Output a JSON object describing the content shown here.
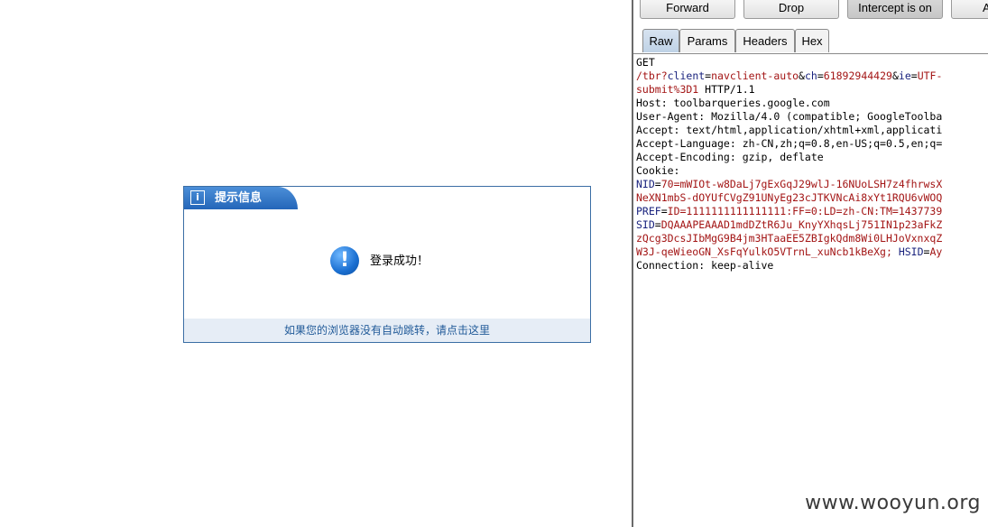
{
  "notice": {
    "title": "提示信息",
    "info_glyph": "i",
    "message": "登录成功！",
    "icon_glyph": "!",
    "redirect_link": "如果您的浏览器没有自动跳转，请点击这里"
  },
  "proxy": {
    "buttons": [
      "Forward",
      "Drop",
      "Intercept is on",
      "A"
    ],
    "tabs": [
      "Raw",
      "Params",
      "Headers",
      "Hex"
    ],
    "active_tab": "Raw",
    "request": {
      "line1": "GET",
      "line2_path": "/tbr?",
      "line2_k1": "client",
      "line2_v1": "navclient-auto",
      "line2_k2": "ch",
      "line2_v2": "61892944429",
      "line2_k3": "ie",
      "line2_v3": "UTF-",
      "line3_v": "submit%3D1",
      "line3_t": " HTTP/1.1",
      "host": "Host: toolbarqueries.google.com",
      "user_agent": "User-Agent: Mozilla/4.0 (compatible; GoogleToolba",
      "accept": "Accept: text/html,application/xhtml+xml,applicati",
      "accept_language": "Accept-Language: zh-CN,zh;q=0.8,en-US;q=0.5,en;q=",
      "accept_encoding": "Accept-Encoding: gzip, deflate",
      "cookie": "Cookie:",
      "nid_k": "NID",
      "nid_v": "70=mWIOt-w8DaLj7gExGqJ29wlJ-16NUoLSH7z4fhrwsX",
      "nid_cont": "NeXN1mbS-dOYUfCVgZ91UNyEg23cJTKVNcAi8xYt1RQU6vWOQ",
      "pref_k": "PREF",
      "pref_v": "ID=1111111111111111:FF=0:LD=zh-CN:TM=1437739",
      "sid_k": "SID",
      "sid_v": "DQAAAPEAAAD1mdDZtR6Ju_KnyYXhqsLj751IN1p23aFkZ",
      "sid_cont": "zQcg3DcsJIbMgG9B4jm3HTaaEE5ZBIgkQdm8Wi0LHJoVxnxqZ",
      "sid_cont2": "W3J-qeWieoGN_XsFqYulkO5VTrnL_xuNcb1kBeXg;",
      "hsid_k": "HSID",
      "hsid_v": "Ay",
      "connection": "Connection: keep-alive"
    }
  },
  "watermark": "www.wooyun.org"
}
